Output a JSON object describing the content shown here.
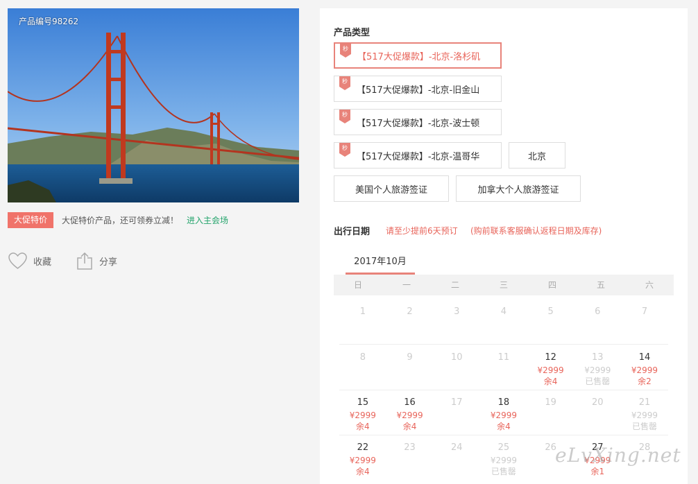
{
  "gallery": {
    "product_code": "产品编号98262"
  },
  "promo": {
    "badge": "大促特价",
    "text": "大促特价产品，还可领券立减！",
    "link": "进入主会场"
  },
  "actions": {
    "favorite": "收藏",
    "share": "分享"
  },
  "product_type": {
    "title": "产品类型",
    "flag_label": "秒",
    "options": [
      "【517大促爆款】-北京-洛杉矶",
      "【517大促爆款】-北京-旧金山",
      "【517大促爆款】-北京-波士顿",
      "【517大促爆款】-北京-温哥华",
      "北京",
      "美国个人旅游签证",
      "加拿大个人旅游签证"
    ]
  },
  "departure": {
    "title": "出行日期",
    "note1": "请至少提前6天预订",
    "note2": "(购前联系客服确认返程日期及库存)"
  },
  "calendar": {
    "month": "2017年10月",
    "weekdays": [
      "日",
      "一",
      "二",
      "三",
      "四",
      "五",
      "六"
    ],
    "weeks": [
      [
        {
          "day": "1"
        },
        {
          "day": "2"
        },
        {
          "day": "3"
        },
        {
          "day": "4"
        },
        {
          "day": "5"
        },
        {
          "day": "6"
        },
        {
          "day": "7"
        }
      ],
      [
        {
          "day": "8"
        },
        {
          "day": "9"
        },
        {
          "day": "10"
        },
        {
          "day": "11"
        },
        {
          "day": "12",
          "price": "¥2999",
          "status": "余4"
        },
        {
          "day": "13",
          "price": "¥2999",
          "status": "已售罄",
          "sold": true
        },
        {
          "day": "14",
          "price": "¥2999",
          "status": "余2"
        }
      ],
      [
        {
          "day": "15",
          "price": "¥2999",
          "status": "余4"
        },
        {
          "day": "16",
          "price": "¥2999",
          "status": "余4"
        },
        {
          "day": "17"
        },
        {
          "day": "18",
          "price": "¥2999",
          "status": "余4"
        },
        {
          "day": "19"
        },
        {
          "day": "20"
        },
        {
          "day": "21",
          "price": "¥2999",
          "status": "已售罄",
          "sold": true
        }
      ],
      [
        {
          "day": "22",
          "price": "¥2999",
          "status": "余4"
        },
        {
          "day": "23"
        },
        {
          "day": "24"
        },
        {
          "day": "25",
          "price": "¥2999",
          "status": "已售罄",
          "sold": true
        },
        {
          "day": "26"
        },
        {
          "day": "27",
          "price": "¥2999",
          "status": "余1"
        },
        {
          "day": "28"
        }
      ]
    ]
  },
  "watermark": "eLvXing.net",
  "colors": {
    "accent": "#e8645a",
    "badge": "#f0736a",
    "link": "#24a46c"
  }
}
